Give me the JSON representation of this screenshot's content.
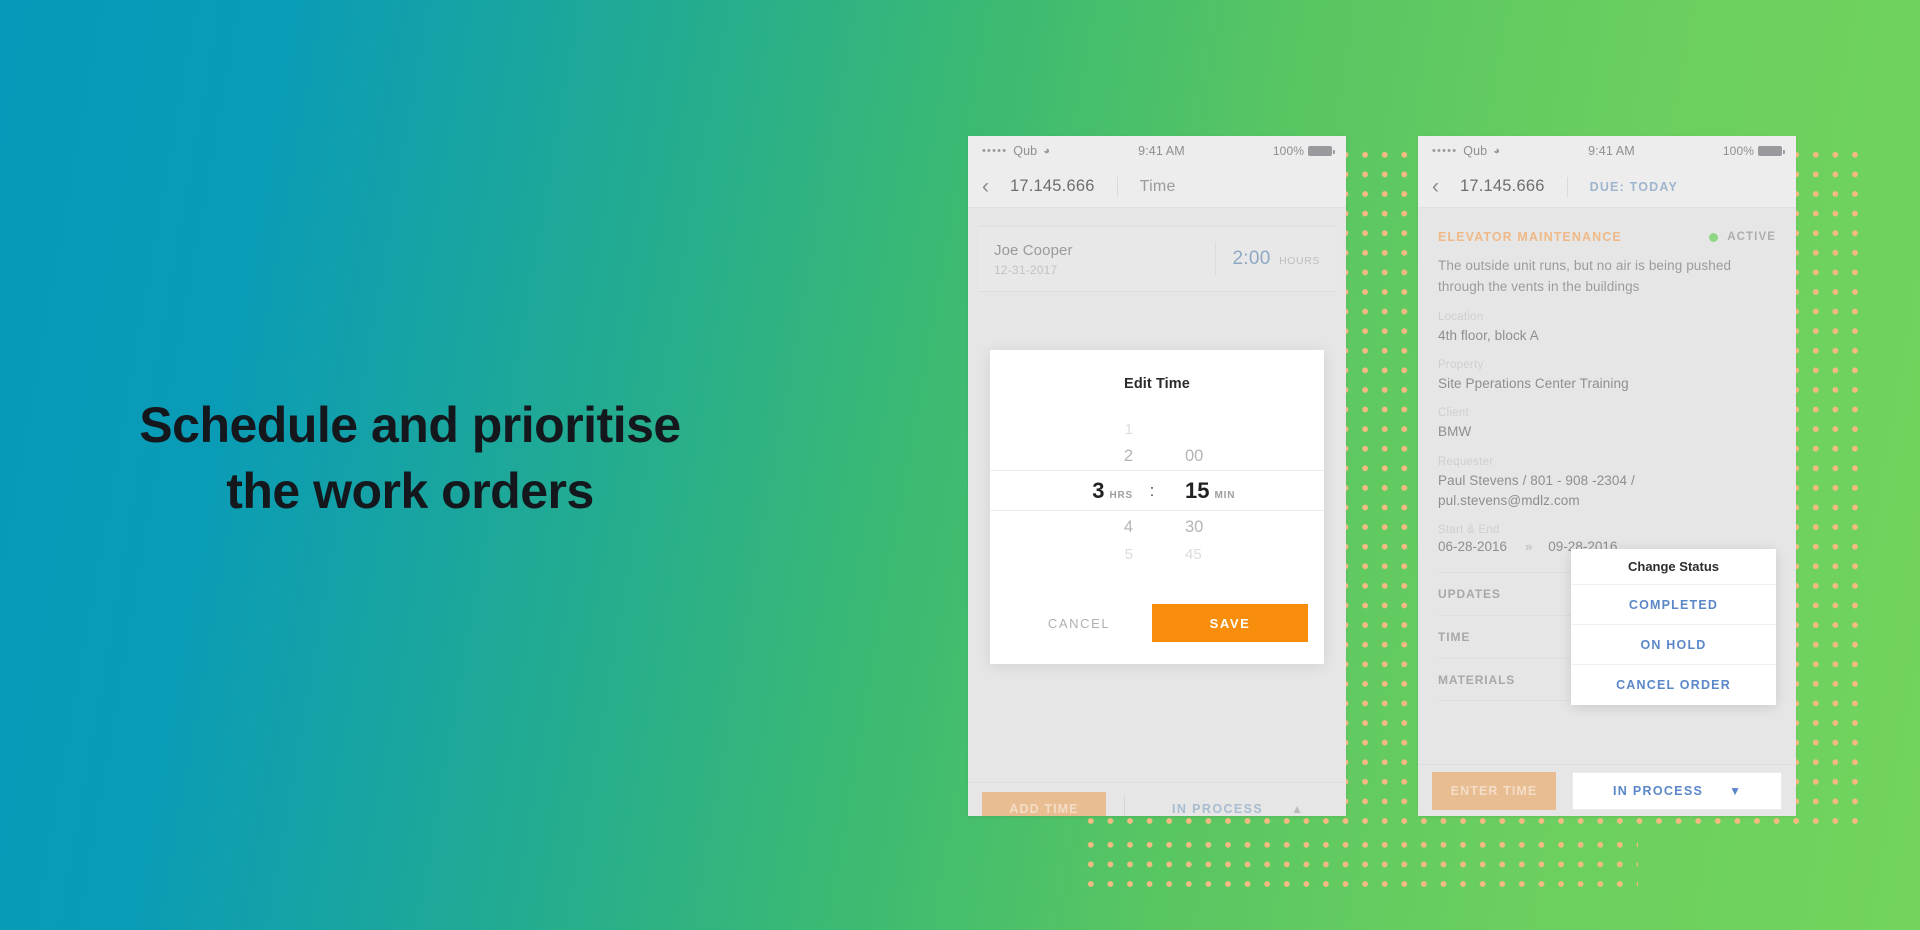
{
  "headline": {
    "line1": "Schedule and prioritise",
    "line2": "the work orders"
  },
  "colors": {
    "gradient_start": "#0699b9",
    "gradient_end": "#72d45e",
    "accent_orange": "#f98d0c",
    "dot_pattern": "#f9b982",
    "link_blue": "#5b87c9",
    "muted_peach": "#e8bd92",
    "status_green": "#8fd685"
  },
  "phone_left": {
    "status_bar": {
      "signal": "•••••",
      "carrier": "Qub",
      "wifi_icon": "wifi-icon",
      "time": "9:41 AM",
      "battery_percent": "100%",
      "battery_icon": "battery-icon"
    },
    "nav": {
      "back_icon": "chevron-left-icon",
      "order_id": "17.145.666",
      "title": "Time"
    },
    "time_entry": {
      "name": "Joe Cooper",
      "date": "12-31-2017",
      "value": "2:00",
      "unit": "HOURS"
    },
    "modal": {
      "title": "Edit Time",
      "hours": {
        "above2": "1",
        "above1": "2",
        "selected": "3",
        "unit": "HRS",
        "below1": "4",
        "below2": "5"
      },
      "colon": ":",
      "minutes": {
        "above2": "",
        "above1": "00",
        "selected": "15",
        "unit": "MIN",
        "below1": "30",
        "below2": "45"
      },
      "cancel_label": "CANCEL",
      "save_label": "SAVE"
    },
    "bottom_bar": {
      "add_time_label": "ADD TIME",
      "status_label": "IN PROCESS",
      "chevron_icon": "chevron-up-icon"
    }
  },
  "phone_right": {
    "status_bar": {
      "signal": "•••••",
      "carrier": "Qub",
      "wifi_icon": "wifi-icon",
      "time": "9:41 AM",
      "battery_percent": "100%",
      "battery_icon": "battery-icon"
    },
    "nav": {
      "back_icon": "chevron-left-icon",
      "order_id": "17.145.666",
      "due": "DUE: TODAY"
    },
    "work_order": {
      "type": "ELEVATOR MAINTENANCE",
      "status": "ACTIVE",
      "status_dot_icon": "status-dot-icon",
      "description": "The outside unit runs, but no air is being pushed through the vents in the buildings",
      "fields": [
        {
          "label": "Location",
          "value": "4th floor, block A"
        },
        {
          "label": "Property",
          "value": "Site Pperations Center Training"
        },
        {
          "label": "Client",
          "value": "BMW"
        },
        {
          "label": "Requester",
          "value": "Paul Stevens / 801 - 908 -2304 / pul.stevens@mdlz.com"
        }
      ],
      "start_end": {
        "label": "Start & End",
        "start": "06-28-2016",
        "arrow_icon": "double-chevron-right-icon",
        "end": "09-28-2016"
      },
      "sections": [
        "UPDATES",
        "TIME",
        "MATERIALS"
      ]
    },
    "status_menu": {
      "title": "Change Status",
      "options": [
        "COMPLETED",
        "ON HOLD",
        "CANCEL ORDER"
      ]
    },
    "bottom_bar": {
      "enter_time_label": "ENTER TIME",
      "status_label": "IN PROCESS",
      "chevron_icon": "chevron-down-icon"
    }
  }
}
